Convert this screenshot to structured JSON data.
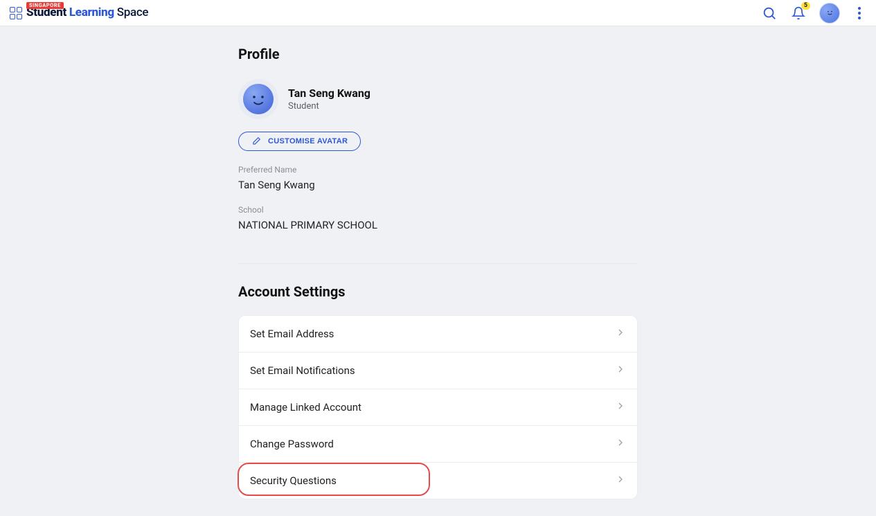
{
  "brand": {
    "badge": "SINGAPORE",
    "title_student": "Student",
    "title_learning": "Learning",
    "title_space": "Space"
  },
  "topbar": {
    "notification_count": "5"
  },
  "profile": {
    "heading": "Profile",
    "name": "Tan Seng Kwang",
    "role": "Student",
    "customise_label": "CUSTOMISE AVATAR",
    "preferred_name_label": "Preferred Name",
    "preferred_name_value": "Tan Seng Kwang",
    "school_label": "School",
    "school_value": "NATIONAL PRIMARY SCHOOL"
  },
  "account": {
    "heading": "Account Settings",
    "items": [
      {
        "label": "Set Email Address"
      },
      {
        "label": "Set Email Notifications"
      },
      {
        "label": "Manage Linked Account"
      },
      {
        "label": "Change Password"
      },
      {
        "label": "Security Questions"
      }
    ]
  }
}
